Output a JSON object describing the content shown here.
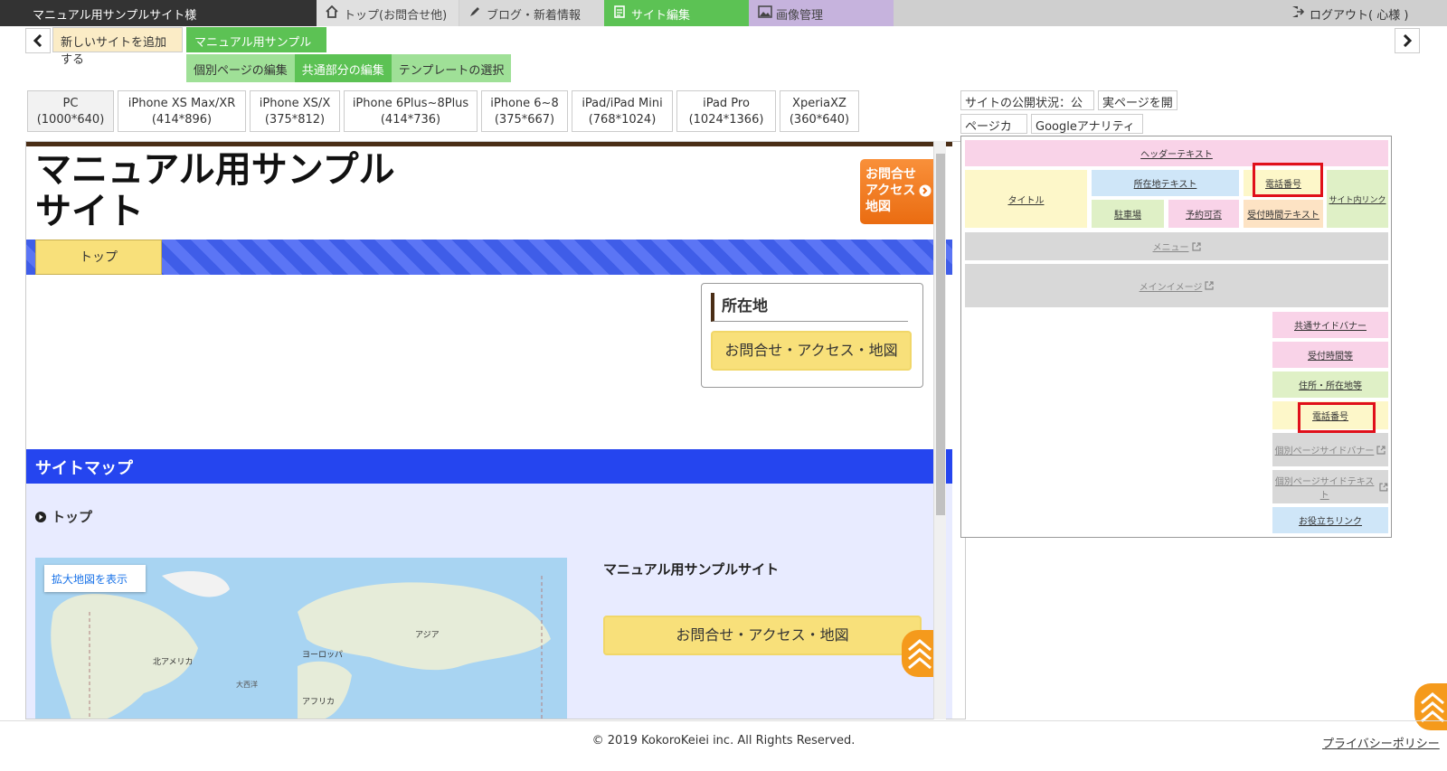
{
  "topbar": {
    "site_name": "マニュアル用サンプルサイト様",
    "home_tab": "トップ(お問合せ他)",
    "blog_tab": "ブログ・新着情報",
    "edit_tab": "サイト編集",
    "image_tab": "画像管理",
    "logout": "ログアウト( 心様 )"
  },
  "site_tabs": {
    "add_site": "新しいサイトを追加する",
    "current_site": "マニュアル用サンプルサイト"
  },
  "sub_tabs": [
    "個別ページの編集",
    "共通部分の編集",
    "テンプレートの選択"
  ],
  "devices": [
    {
      "name": "PC",
      "size": "(1000*640)"
    },
    {
      "name": "iPhone XS Max/XR",
      "size": "(414*896)"
    },
    {
      "name": "iPhone XS/X",
      "size": "(375*812)"
    },
    {
      "name": "iPhone 6Plus~8Plus",
      "size": "(414*736)"
    },
    {
      "name": "iPhone 6~8",
      "size": "(375*667)"
    },
    {
      "name": "iPad/iPad Mini",
      "size": "(768*1024)"
    },
    {
      "name": "iPad Pro",
      "size": "(1024*1366)"
    },
    {
      "name": "XperiaXZ",
      "size": "(360*640)"
    }
  ],
  "preview": {
    "title_line1": "マニュアル用サンプル",
    "title_line2": "サイト",
    "contact_line1": "お問合せ",
    "contact_line2": "アクセス",
    "contact_line3": "地図",
    "nav_top": "トップ",
    "location_title": "所在地",
    "location_button": "お問合せ・アクセス・地図",
    "sitemap_title": "サイトマップ",
    "sitemap_link": "トップ",
    "map_button": "拡大地図を表示",
    "map_labels": [
      "アジア",
      "ヨーロッパ",
      "北アメリカ",
      "大西洋",
      "アフリカ"
    ],
    "site_name": "マニュアル用サンプルサイト",
    "contact_button": "お問合せ・アクセス・地図"
  },
  "right_panel": {
    "publish_status": "サイトの公開状況：公開",
    "open_page": "実ページを開く",
    "page_color": "ページカラー",
    "analytics": "Googleアナリティクス"
  },
  "layout_blocks": {
    "header_text": "ヘッダーテキスト",
    "title": "タイトル",
    "address_text": "所在地テキスト",
    "phone": "電話番号",
    "internal_link": "サイト内リンク",
    "parking": "駐車場",
    "reservation": "予約可否",
    "hours_text": "受付時間テキスト",
    "menu": "メニュー",
    "main_image": "メインイメージ",
    "common_banner": "共通サイドバナー",
    "hours": "受付時間等",
    "address": "住所・所在地等",
    "phone2": "電話番号",
    "page_side_banner": "個別ページサイドバナー",
    "page_side_text": "個別ページサイドテキスト",
    "useful_links": "お役立ちリンク"
  },
  "footer": {
    "copyright": "© 2019 KokoroKeiei inc. All Rights Reserved.",
    "privacy": "プライバシーポリシー"
  }
}
